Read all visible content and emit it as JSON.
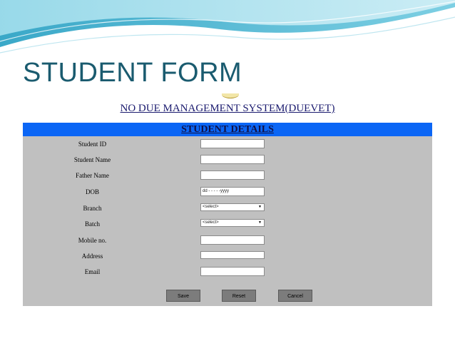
{
  "slide": {
    "title": "STUDENT FORM"
  },
  "app": {
    "title": "NO DUE MANAGEMENT SYSTEM(DUEVET)",
    "section_title": "STUDENT DETAILS"
  },
  "form": {
    "fields": [
      {
        "label": "Student ID",
        "type": "text",
        "value": ""
      },
      {
        "label": "Student Name",
        "type": "text",
        "value": ""
      },
      {
        "label": "Father Name",
        "type": "text",
        "value": ""
      },
      {
        "label": "DOB",
        "type": "date",
        "value": "dd - - - - -yyyy"
      },
      {
        "label": "Branch",
        "type": "select",
        "value": "<select>"
      },
      {
        "label": "Batch",
        "type": "select",
        "value": "<select>"
      },
      {
        "label": "Mobile no.",
        "type": "text",
        "value": ""
      },
      {
        "label": "Address",
        "type": "text",
        "value": ""
      },
      {
        "label": "Email",
        "type": "text",
        "value": ""
      }
    ],
    "buttons": {
      "save": "Save",
      "reset": "Reset",
      "cancel": "Cancel"
    }
  },
  "colors": {
    "title_text": "#1a5b6f",
    "form_bg": "#c0c0c0",
    "header_bar": "#0b66f5",
    "button_bg": "#7c7c7c"
  }
}
